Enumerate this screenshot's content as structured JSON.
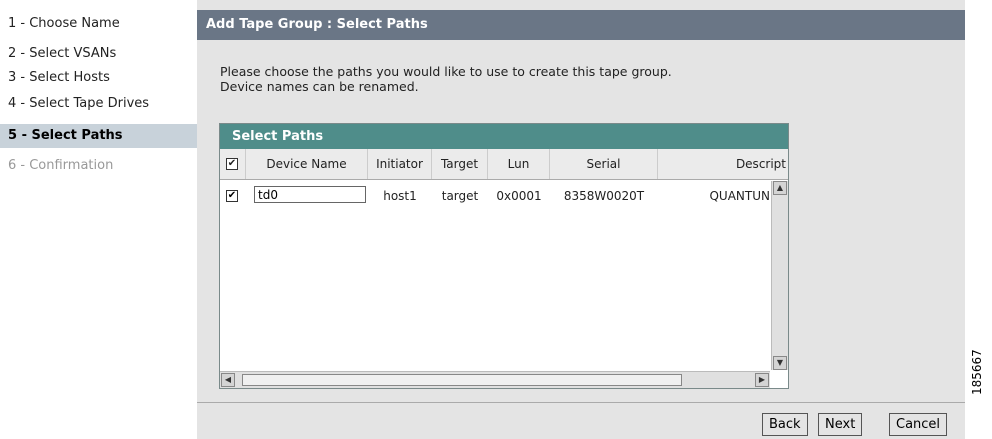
{
  "steps": [
    {
      "label": "1 - Choose Name"
    },
    {
      "label": "2 - Select VSANs"
    },
    {
      "label": "3 - Select Hosts"
    },
    {
      "label": "4 - Select Tape Drives"
    },
    {
      "label": "5 - Select Paths"
    },
    {
      "label": "6 - Confirmation"
    }
  ],
  "panel": {
    "title": "Add Tape Group : Select Paths",
    "description_line1": "Please choose the paths you would like to use to create this tape group.",
    "description_line2": "Device names can be renamed."
  },
  "grid": {
    "title": "Select Paths",
    "columns": [
      "Device Name",
      "Initiator",
      "Target",
      "Lun",
      "Serial",
      "Descript"
    ],
    "rows": [
      {
        "checked": true,
        "device_name": "td0",
        "initiator": "host1",
        "target": "target",
        "lun": "0x0001",
        "serial": "8358W0020T",
        "description": "QUANTUN"
      }
    ]
  },
  "buttons": {
    "back": "Back",
    "next": "Next",
    "cancel": "Cancel"
  },
  "figure_number": "185667"
}
